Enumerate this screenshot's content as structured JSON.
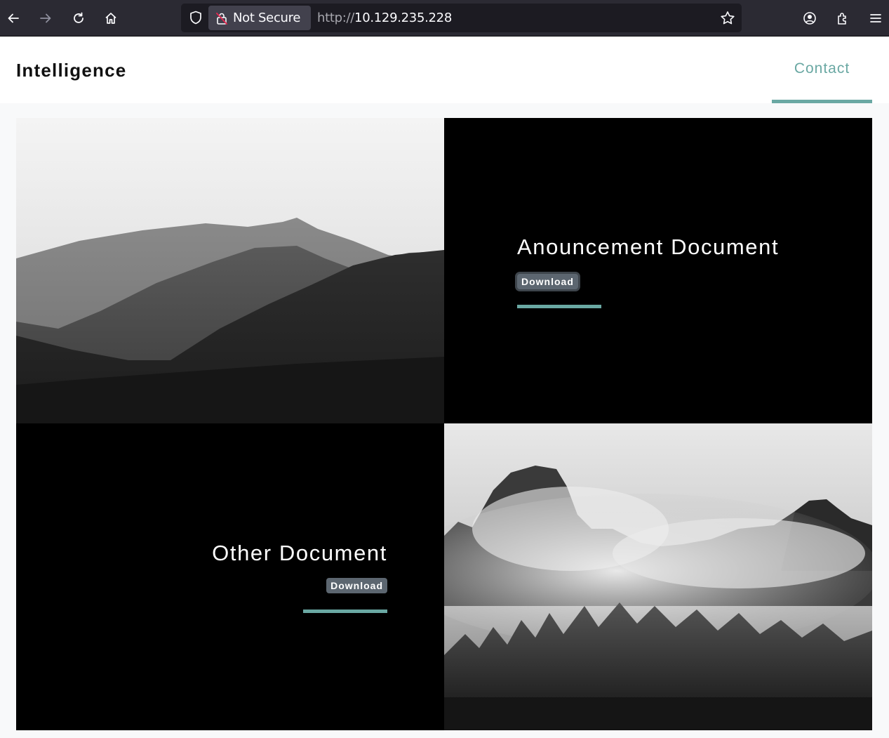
{
  "browser": {
    "security_label": "Not Secure",
    "url_scheme": "http://",
    "url_host": "10.129.235.228"
  },
  "site": {
    "brand": "Intelligence",
    "nav": {
      "contact": "Contact"
    }
  },
  "documents": [
    {
      "title": "Anouncement Document",
      "button": "Download"
    },
    {
      "title": "Other Document",
      "button": "Download"
    }
  ],
  "colors": {
    "accent": "#6aa8a3",
    "button_bg": "#5c6670",
    "chrome_bg": "#2b2a33"
  },
  "icons": [
    "back-icon",
    "forward-icon",
    "reload-icon",
    "home-icon",
    "shield-icon",
    "lock-icon",
    "bookmark-star-icon",
    "account-icon",
    "extensions-icon",
    "menu-icon"
  ]
}
